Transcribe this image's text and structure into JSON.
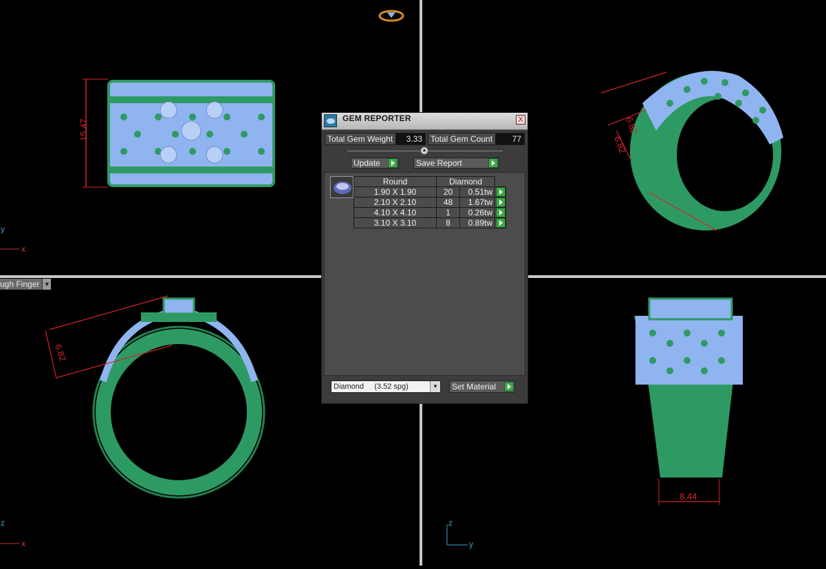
{
  "viewports": {
    "front": {
      "dimension": "15.47",
      "axes": [
        "y",
        "x"
      ]
    },
    "perspective": {
      "dimensions": [
        "6.82",
        "6.82"
      ]
    },
    "side": {
      "dimension": "6.82",
      "menu_label": "ugh Finger",
      "axes": [
        "z",
        "x"
      ]
    },
    "top": {
      "dimension": "8.44",
      "axes": [
        "z",
        "y"
      ]
    }
  },
  "gem_reporter": {
    "title": "GEM REPORTER",
    "close_symbol": "X",
    "total_weight_label": "Total Gem Weight",
    "total_weight_value": "3.33",
    "total_count_label": "Total Gem Count",
    "total_count_value": "77",
    "update_label": "Update",
    "save_report_label": "Save Report",
    "table": {
      "shape_header": "Round",
      "material_header": "Diamond",
      "rows": [
        {
          "size": "1.90 X 1.90",
          "count": "20",
          "weight": "0.51tw"
        },
        {
          "size": "2.10 X 2.10",
          "count": "48",
          "weight": "1.67tw"
        },
        {
          "size": "4.10 X 4.10",
          "count": "1",
          "weight": "0.26tw"
        },
        {
          "size": "3.10 X 3.10",
          "count": "8",
          "weight": "0.89tw"
        }
      ]
    },
    "material_select": "Diamond     (3.52 spg)",
    "set_material_label": "Set Material"
  },
  "colors": {
    "metal": "#2e9a63",
    "gem": "#8fb4ef",
    "dimension": "#d3262a",
    "panel": "#3c3c3c"
  }
}
